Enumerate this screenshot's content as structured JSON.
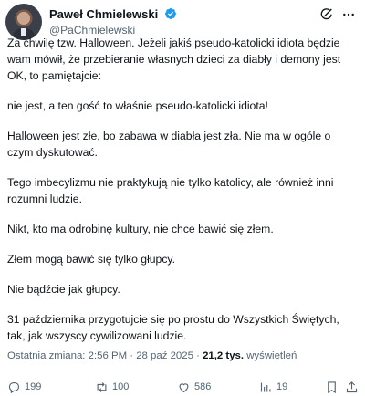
{
  "author": {
    "display_name": "Paweł Chmielewski",
    "handle": "@PaChmielewski",
    "verified_color": "#1d9bf0"
  },
  "icons": {
    "verified": "verified-badge-icon",
    "grok": "grok-icon",
    "more": "more-options-icon",
    "reply": "reply-icon",
    "repost": "repost-icon",
    "like": "like-icon",
    "views": "views-icon",
    "bookmark": "bookmark-icon",
    "share": "share-icon"
  },
  "post": {
    "paragraphs": [
      "Za chwilę tzw. Halloween. Jeżeli jakiś pseudo-katolicki idiota będzie wam mówił, że przebieranie własnych dzieci za diabły i demony jest OK, to pamiętajcie:",
      "nie jest, a ten gość to właśnie pseudo-katolicki idiota!",
      "Halloween jest złe, bo zabawa w diabła jest zła. Nie ma w ogóle o czym dyskutować.",
      "Tego imbecylizmu nie praktykują nie tylko katolicy, ale również inni rozumni ludzie.",
      "Nikt, kto ma odrobinę kultury, nie chce bawić się złem.",
      "Złem mogą bawić się tylko głupcy.",
      "Nie bądźcie jak głupcy.",
      "31 października przygotujcie się po prostu do Wszystkich Świętych, tak, jak wszyscy cywilizowani ludzie."
    ],
    "edited_label": "Ostatnia zmiana:",
    "time": "2:56 PM",
    "separator": "·",
    "date": "28 paź 2025",
    "views_count": "21,2 tys.",
    "views_label": "wyświetleń"
  },
  "actions": {
    "replies": "199",
    "reposts": "100",
    "likes": "586",
    "bookmarks": "19"
  }
}
